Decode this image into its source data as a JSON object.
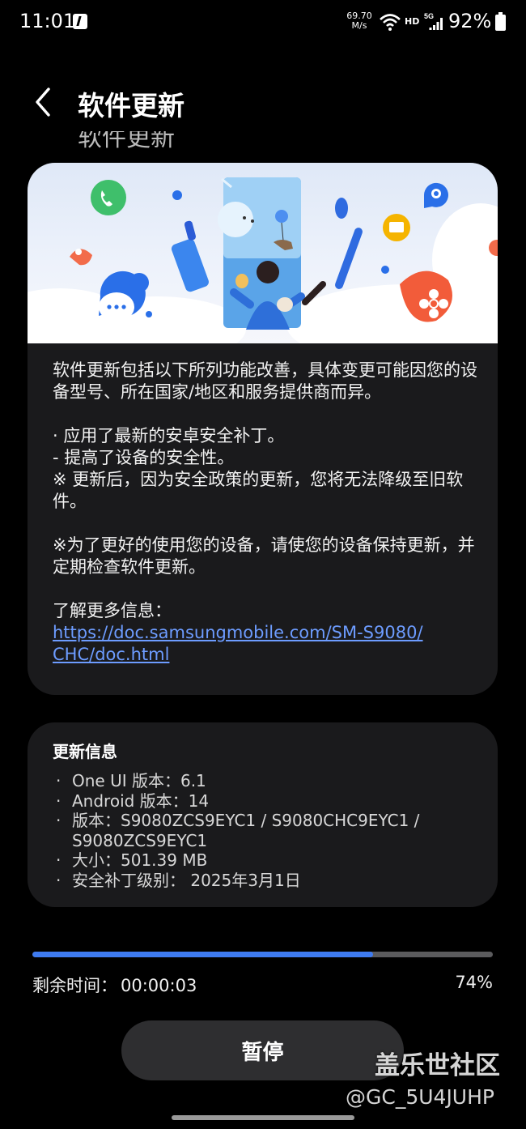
{
  "status_bar": {
    "time": "11:01",
    "net_speed_value": "69.70",
    "net_speed_unit": "M/s",
    "hd_label": "HD",
    "network_type": "5G",
    "battery": "92%"
  },
  "header": {
    "title": "软件更新",
    "scrolled_text": "软件更新"
  },
  "release_notes": {
    "intro": "软件更新包括以下所列功能改善，具体变更可能因您的设备型号、所在国家/地区和服务提供商而异。",
    "bullet_1": "· 应用了最新的安卓安全补丁。",
    "bullet_1_sub": "- 提高了设备的安全性。",
    "warning": "※ 更新后，因为安全政策的更新，您将无法降级至旧软件。",
    "advice": "※为了更好的使用您的设备，请使您的设备保持更新，并定期检查软件更新。",
    "more_info_label": "了解更多信息：",
    "more_info_link": "https://doc.samsungmobile.com/SM-S9080/CHC/doc.html"
  },
  "update_info": {
    "title": "更新信息",
    "items": [
      "One UI 版本：6.1",
      "Android 版本：14",
      "版本：S9080ZCS9EYC1 / S9080CHC9EYC1 / S9080ZCS9EYC1",
      "大小：501.39 MB",
      "安全补丁级别： 2025年3月1日"
    ]
  },
  "progress": {
    "fraction": 0.74,
    "remaining_label": "剩余时间：",
    "remaining_time": "00:00:03",
    "percent_text": "74%"
  },
  "pause_button_label": "暂停",
  "watermark": {
    "community": "盖乐世社区",
    "user": "@GC_5U4JUHP"
  },
  "colors": {
    "accent": "#3e7bf1",
    "card_bg": "#1a1a1c",
    "link": "#6d9cff"
  }
}
